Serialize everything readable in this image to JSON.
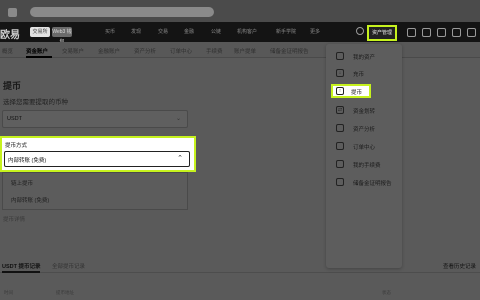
{
  "nav": {
    "logo": "欧易",
    "pill1": "交易所",
    "pill2": "Web3 钱包",
    "items": [
      "买币",
      "发现",
      "交易",
      "金融",
      "公链",
      "机构客户",
      "新手学院",
      "更多"
    ],
    "asset_button": "资产管理"
  },
  "subnav": {
    "items": [
      "概览",
      "资金账户",
      "交易账户",
      "金融账户",
      "资产分析",
      "订单中心",
      "手续费",
      "账户提单",
      "储备金证明报告"
    ]
  },
  "page": {
    "title": "提币",
    "currency_label": "选择您需要提取的币种",
    "currency_value": "USDT",
    "method_label": "提币方式",
    "method_value": "内部转账 (免费)",
    "options": [
      "链上提币",
      "内部转账 (免费)"
    ],
    "detail_link": "提币详情"
  },
  "records": {
    "tab_active": "USDT 提币记录",
    "tab_all": "全部提币记录",
    "view_all": "查看历史记录",
    "columns": [
      "时间",
      "提币地址",
      "",
      "",
      "",
      "",
      "",
      "状态"
    ]
  },
  "menu": {
    "items": [
      {
        "label": "我的资产",
        "icon": "wallet-icon"
      },
      {
        "label": "充币",
        "icon": "deposit-icon"
      },
      {
        "label": "提币",
        "icon": "withdraw-icon"
      },
      {
        "label": "资金划转",
        "icon": "transfer-icon"
      },
      {
        "label": "资产分析",
        "icon": "analysis-icon"
      },
      {
        "label": "订单中心",
        "icon": "order-icon"
      },
      {
        "label": "我的手续费",
        "icon": "fee-icon"
      },
      {
        "label": "储备金证明报告",
        "icon": "report-icon"
      }
    ]
  },
  "colors": {
    "highlight": "#c6f21e",
    "nav_bg": "#141414"
  }
}
